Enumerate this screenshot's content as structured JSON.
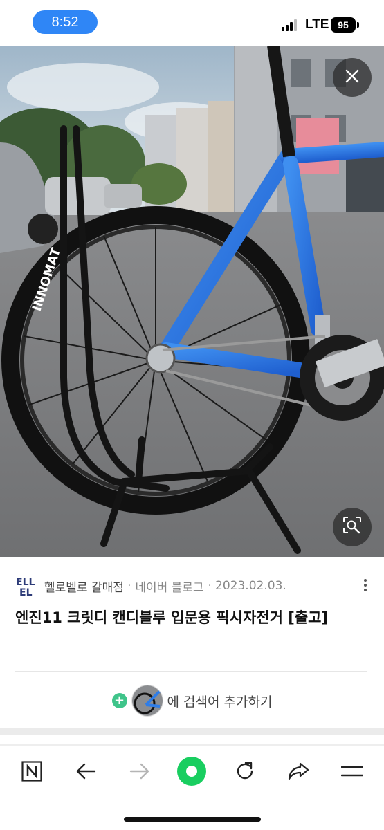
{
  "status_bar": {
    "time": "8:52",
    "network": "LTE",
    "battery": "95"
  },
  "image_viewer": {
    "close_icon": "close-icon",
    "lens_icon": "image-search-icon"
  },
  "source": {
    "logo_text": "ELLEL",
    "name": "헬로벨로 갈매점",
    "separator": "·",
    "type": "네이버 블로그",
    "date": "2023.02.03."
  },
  "title": "엔진11 크릿디 캔디블루 입문용 픽시자전거 [출고]",
  "add_search": {
    "plus": "+",
    "text": "에 검색어 추가하기"
  },
  "colors": {
    "accent_blue": "#2f86f6",
    "naver_green": "#19ce60",
    "plus_green": "#3fc48a"
  },
  "bottom_nav": {
    "items": [
      "naver-n-icon",
      "back-arrow-icon",
      "forward-arrow-icon",
      "green-dot-icon",
      "refresh-icon",
      "share-icon",
      "menu-icon"
    ]
  }
}
